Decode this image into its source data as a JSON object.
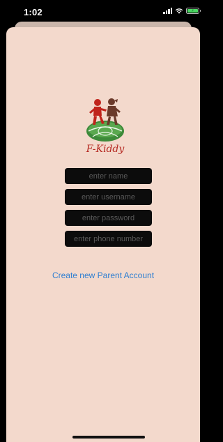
{
  "status_bar": {
    "time": "1:02",
    "battery_label": "⚡"
  },
  "logo": {
    "icon": "f-kiddy-logo-icon",
    "text": "F-Kiddy",
    "colors": {
      "red": "#c0241c",
      "green": "#3d8a3a",
      "brown": "#6b3a2a"
    }
  },
  "form": {
    "name_placeholder": "enter name",
    "username_placeholder": "enter username",
    "password_placeholder": "enter password",
    "phone_placeholder": "enter phone number"
  },
  "create_account_label": "Create new Parent Account",
  "colors": {
    "sheet_background": "#f3d9cc",
    "input_background": "#0c0c0c",
    "link": "#2f7fd1"
  }
}
